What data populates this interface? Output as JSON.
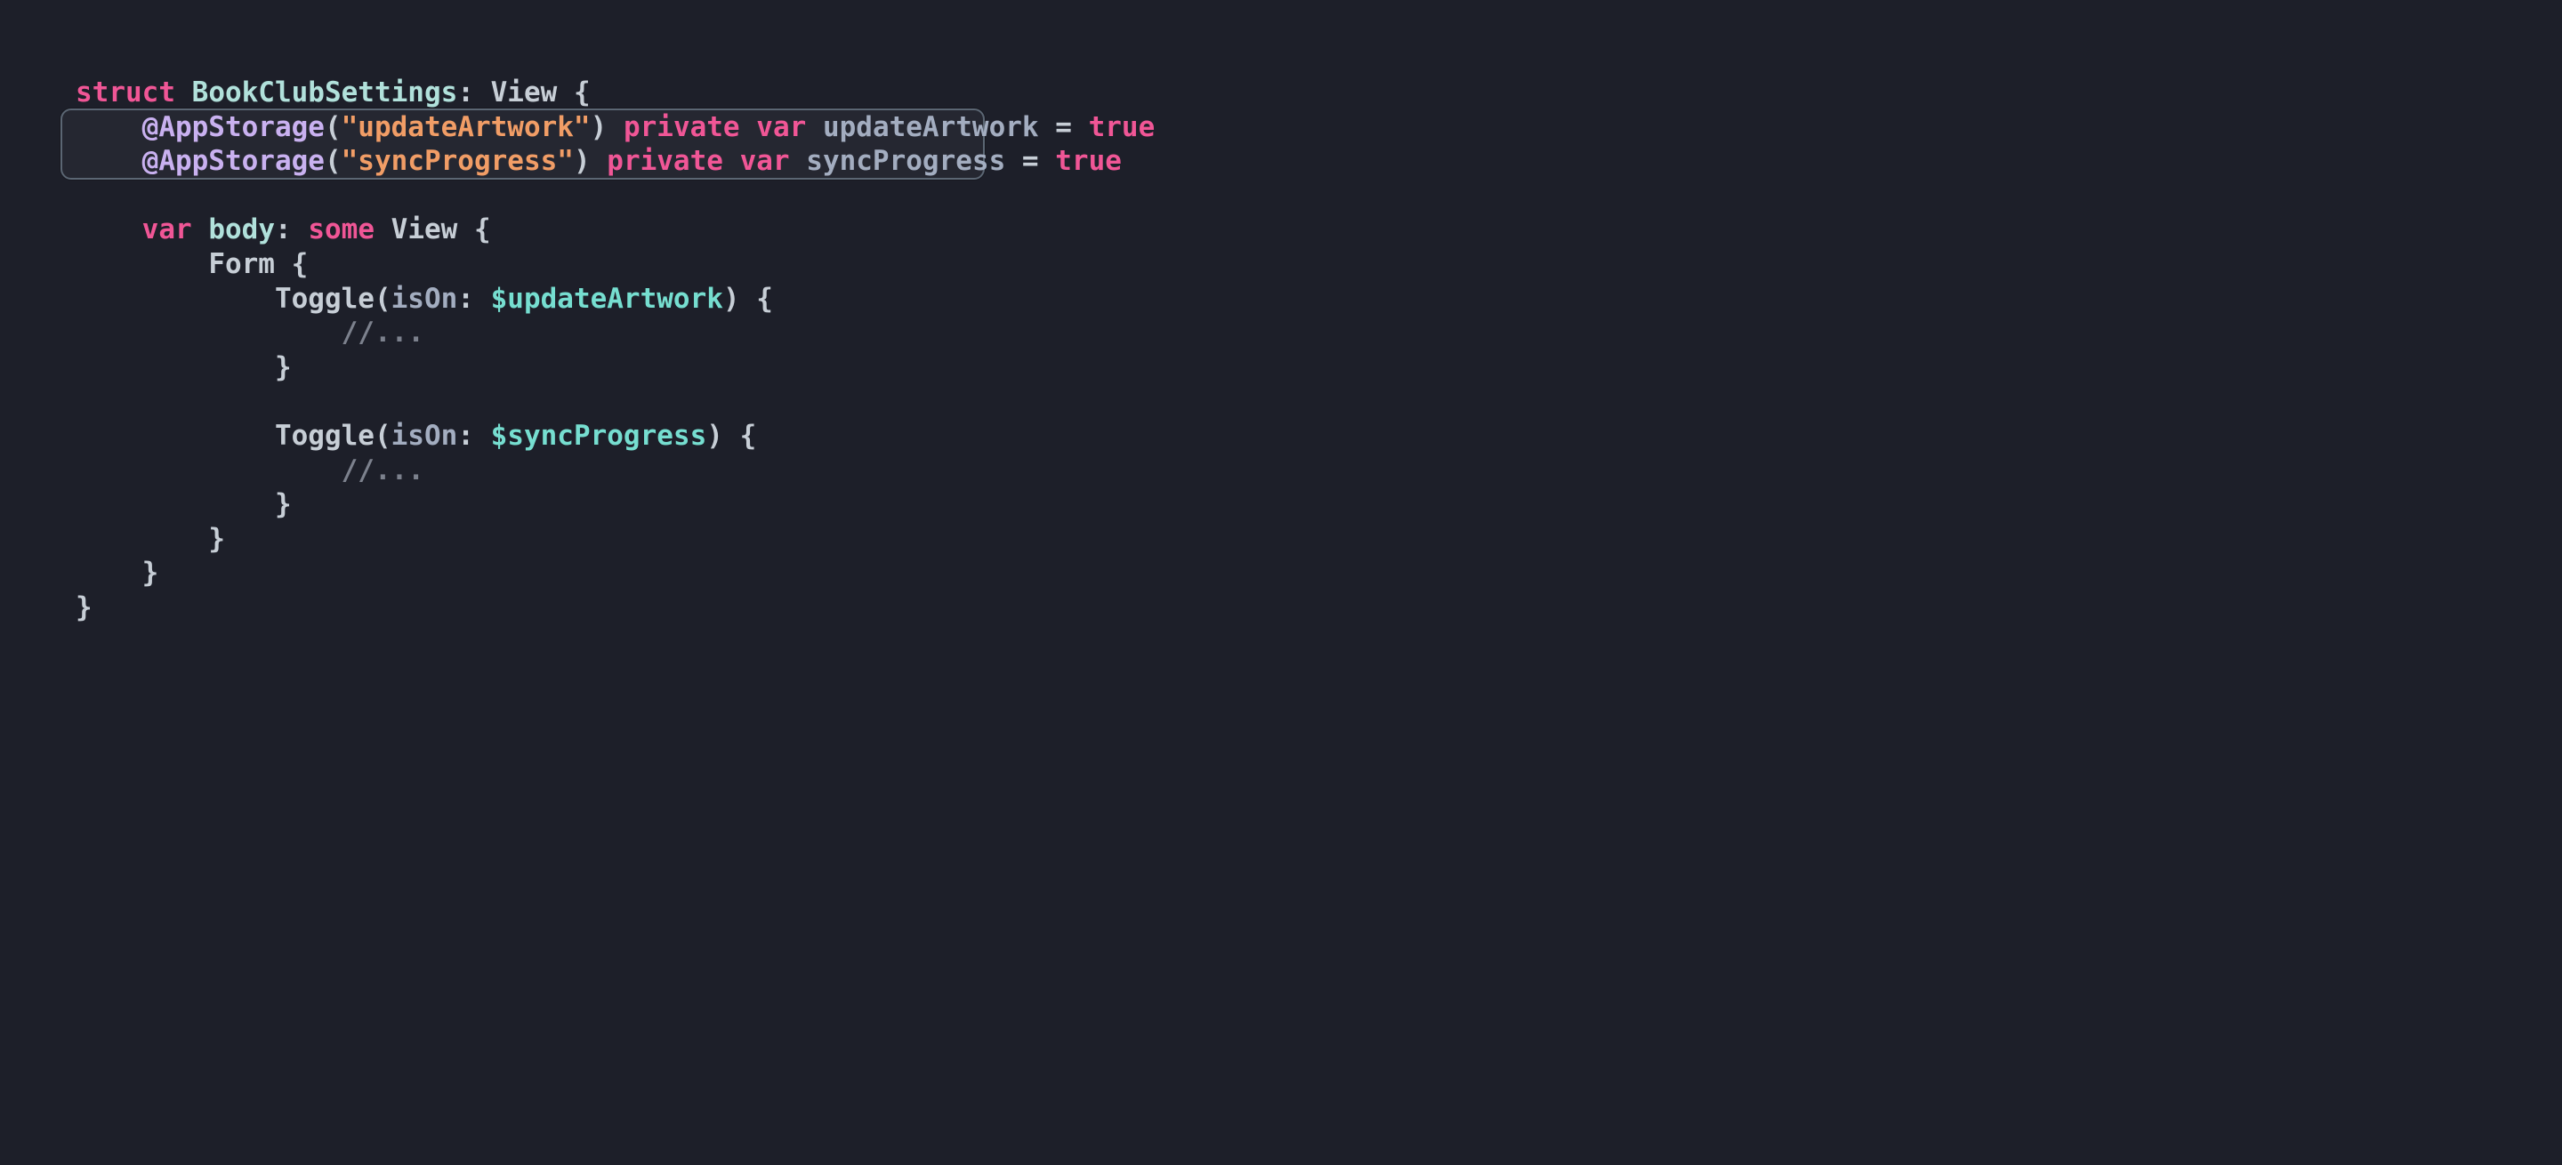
{
  "colors": {
    "background": "#1d1f29",
    "keyword": "#f05696",
    "type": "#b1e1db",
    "identifier": "#a3adc0",
    "attribute": "#c9b1f0",
    "string": "#f19d66",
    "plain": "#c7ced6",
    "binding": "#76ded0",
    "comment": "#7c818d",
    "highlight_border": "#5b6673"
  },
  "indent": "    ",
  "code": {
    "line1": {
      "struct_kw": "struct",
      "name": "BookClubSettings",
      "colon": ":",
      "proto": "View",
      "brace": "{"
    },
    "line2": {
      "attr": "@AppStorage",
      "lparen": "(",
      "str": "\"updateArtwork\"",
      "rparen": ")",
      "private_kw": "private",
      "var_kw": "var",
      "name": "updateArtwork",
      "eq": "=",
      "val": "true"
    },
    "line3": {
      "attr": "@AppStorage",
      "lparen": "(",
      "str": "\"syncProgress\"",
      "rparen": ")",
      "private_kw": "private",
      "var_kw": "var",
      "name": "syncProgress",
      "eq": "=",
      "val": "true"
    },
    "line4": "",
    "line5": {
      "var_kw": "var",
      "name": "body",
      "colon": ":",
      "some_kw": "some",
      "type": "View",
      "brace": "{"
    },
    "line6": {
      "form": "Form",
      "brace": "{"
    },
    "line7": {
      "toggle": "Toggle",
      "lparen": "(",
      "label": "isOn",
      "colon": ":",
      "binding": "$updateArtwork",
      "rparen": ")",
      "brace": "{"
    },
    "line8": {
      "comment": "//..."
    },
    "line9": {
      "brace": "}"
    },
    "line10": "",
    "line11": {
      "toggle": "Toggle",
      "lparen": "(",
      "label": "isOn",
      "colon": ":",
      "binding": "$syncProgress",
      "rparen": ")",
      "brace": "{"
    },
    "line12": {
      "comment": "//..."
    },
    "line13": {
      "brace": "}"
    },
    "line14": {
      "brace": "}"
    },
    "line15": {
      "brace": "}"
    },
    "line16": {
      "brace": "}"
    }
  }
}
